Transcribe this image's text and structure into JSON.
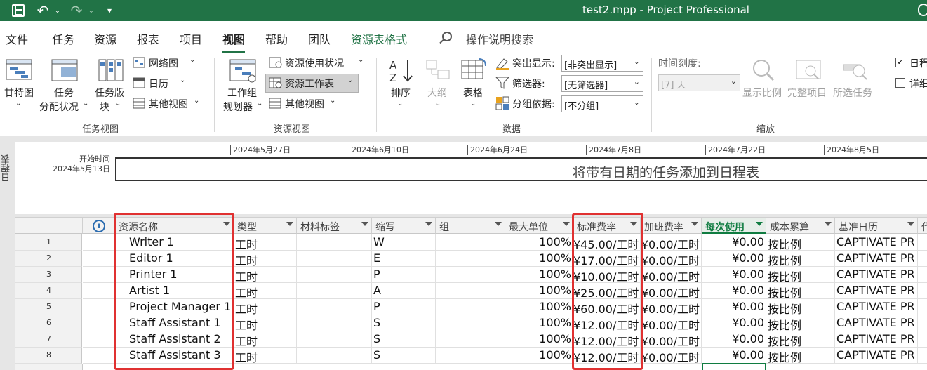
{
  "titlebar": {
    "title": "test2.mpp  -  Project Professional"
  },
  "menu": {
    "tabs": [
      "文件",
      "任务",
      "资源",
      "报表",
      "项目",
      "视图",
      "帮助",
      "团队",
      "资源表格式"
    ],
    "search_placeholder": "操作说明搜索"
  },
  "ribbon": {
    "task_views": {
      "gantt": "甘特图",
      "task_usage_1": "任务",
      "task_usage_2": "分配状况",
      "task_board_1": "任务版",
      "task_board_2": "块",
      "network": "网络图",
      "calendar": "日历",
      "other_views": "其他视图",
      "group_label": "任务视图"
    },
    "resource_views": {
      "team_planner_1": "工作组",
      "team_planner_2": "规划器",
      "resource_usage": "资源使用状况",
      "resource_sheet": "资源工作表",
      "other_views": "其他视图",
      "group_label": "资源视图"
    },
    "data": {
      "sort": "排序",
      "outline": "大纲",
      "tables": "表格",
      "highlight_label": "突出显示:",
      "highlight_value": "[非突出显示]",
      "filter_label": "筛选器:",
      "filter_value": "[无筛选器]",
      "group_by_label": "分组依据:",
      "group_by_value": "[不分组]",
      "group_label": "数据"
    },
    "zoom": {
      "timescale_label": "时间刻度:",
      "timescale_value": "[7] 天",
      "zoom_slider": "显示比例",
      "entire_project": "完整项目",
      "selected_tasks": "所选任务",
      "group_label": "缩放"
    },
    "split_view": {
      "timeline": "日程",
      "details": "详细"
    }
  },
  "timeline": {
    "side_label": "日程表",
    "start_label": "开始时间",
    "start_date": "2024年5月13日",
    "dates": [
      "2024年5月27日",
      "2024年6月10日",
      "2024年6月24日",
      "2024年7月8日",
      "2024年7月22日",
      "2024年8月5日"
    ],
    "message": "将带有日期的任务添加到日程表"
  },
  "grid": {
    "columns": [
      "资源名称",
      "类型",
      "材料标签",
      "缩写",
      "组",
      "最大单位",
      "标准费率",
      "加班费率",
      "每次使用",
      "成本累算",
      "基准日历",
      "代"
    ],
    "rows": [
      {
        "id": "1",
        "name": "Writer 1",
        "type": "工时",
        "initials": "W",
        "max_units": "100%",
        "std_rate": "¥45.00/工时",
        "ovt_rate": "¥0.00/工时",
        "cost_per_use": "¥0.00",
        "accrue": "按比例",
        "base_calendar": "CAPTIVATE PR"
      },
      {
        "id": "2",
        "name": "Editor 1",
        "type": "工时",
        "initials": "E",
        "max_units": "100%",
        "std_rate": "¥17.00/工时",
        "ovt_rate": "¥0.00/工时",
        "cost_per_use": "¥0.00",
        "accrue": "按比例",
        "base_calendar": "CAPTIVATE PR"
      },
      {
        "id": "3",
        "name": "Printer 1",
        "type": "工时",
        "initials": "P",
        "max_units": "100%",
        "std_rate": "¥10.00/工时",
        "ovt_rate": "¥0.00/工时",
        "cost_per_use": "¥0.00",
        "accrue": "按比例",
        "base_calendar": "CAPTIVATE PR"
      },
      {
        "id": "4",
        "name": "Artist 1",
        "type": "工时",
        "initials": "A",
        "max_units": "100%",
        "std_rate": "¥25.00/工时",
        "ovt_rate": "¥0.00/工时",
        "cost_per_use": "¥0.00",
        "accrue": "按比例",
        "base_calendar": "CAPTIVATE PR"
      },
      {
        "id": "5",
        "name": "Project Manager 1",
        "type": "工时",
        "initials": "P",
        "max_units": "100%",
        "std_rate": "¥60.00/工时",
        "ovt_rate": "¥0.00/工时",
        "cost_per_use": "¥0.00",
        "accrue": "按比例",
        "base_calendar": "CAPTIVATE PR"
      },
      {
        "id": "6",
        "name": "Staff Assistant 1",
        "type": "工时",
        "initials": "S",
        "max_units": "100%",
        "std_rate": "¥12.00/工时",
        "ovt_rate": "¥0.00/工时",
        "cost_per_use": "¥0.00",
        "accrue": "按比例",
        "base_calendar": "CAPTIVATE PR"
      },
      {
        "id": "7",
        "name": "Staff Assistant 2",
        "type": "工时",
        "initials": "S",
        "max_units": "100%",
        "std_rate": "¥12.00/工时",
        "ovt_rate": "¥0.00/工时",
        "cost_per_use": "¥0.00",
        "accrue": "按比例",
        "base_calendar": "CAPTIVATE PR"
      },
      {
        "id": "8",
        "name": "Staff Assistant 3",
        "type": "工时",
        "initials": "S",
        "max_units": "100%",
        "std_rate": "¥12.00/工时",
        "ovt_rate": "¥0.00/工时",
        "cost_per_use": "¥0.00",
        "accrue": "按比例",
        "base_calendar": "CAPTIVATE PR"
      }
    ]
  },
  "colors": {
    "accent": "#217346",
    "highlight": "#e03131"
  }
}
